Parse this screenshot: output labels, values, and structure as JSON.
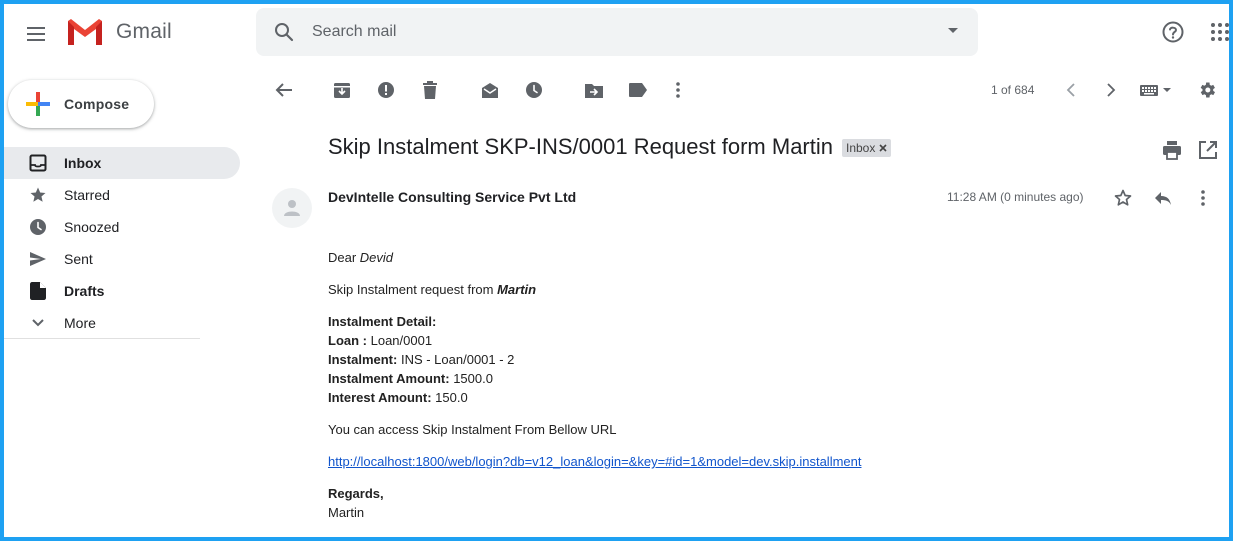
{
  "header": {
    "app_name": "Gmail",
    "search_placeholder": "Search mail"
  },
  "sidebar": {
    "compose_label": "Compose",
    "items": [
      {
        "label": "Inbox",
        "icon": "inbox-icon",
        "active": true
      },
      {
        "label": "Starred",
        "icon": "star-icon"
      },
      {
        "label": "Snoozed",
        "icon": "clock-icon"
      },
      {
        "label": "Sent",
        "icon": "send-icon"
      },
      {
        "label": "Drafts",
        "icon": "draft-icon"
      },
      {
        "label": "More",
        "icon": "chevron-down-icon"
      }
    ]
  },
  "toolbar": {
    "pager": "1 of 684",
    "icons": [
      "back-arrow-icon",
      "archive-icon",
      "report-spam-icon",
      "delete-icon",
      "mark-unread-icon",
      "snooze-icon",
      "move-to-icon",
      "label-icon",
      "more-vert-icon",
      "chevron-left-icon",
      "chevron-right-icon",
      "keyboard-icon",
      "settings-icon"
    ]
  },
  "message": {
    "subject": "Skip Instalment SKP-INS/0001 Request form Martin",
    "label_chip": "Inbox",
    "sender": "DevIntelle Consulting Service Pvt Ltd",
    "time": "11:28 AM (0 minutes ago)",
    "body": {
      "greeting_prefix": "Dear ",
      "greeting_name": "Devid",
      "request_prefix": "Skip Instalment request from ",
      "request_name": "Martin",
      "detail_heading": "Instalment Detail:",
      "loan_label": "Loan :",
      "loan_value": " Loan/0001",
      "instalment_label": "Instalment:",
      "instalment_value": " INS - Loan/0001 - 2",
      "amount_label": "Instalment Amount:",
      "amount_value": " 1500.0",
      "interest_label": "Interest Amount:",
      "interest_value": " 150.0",
      "access_text": "You can access Skip Instalment From Bellow URL",
      "url": "http://localhost:1800/web/login?db=v12_loan&login=&key=#id=1&model=dev.skip.installment",
      "regards": "Regards,",
      "signature": "Martin"
    }
  },
  "colors": {
    "frame_border": "#1ea1f2",
    "active_nav_bg": "#e8eaed",
    "link": "#1155cc",
    "gmail_red": "#ea4335"
  }
}
